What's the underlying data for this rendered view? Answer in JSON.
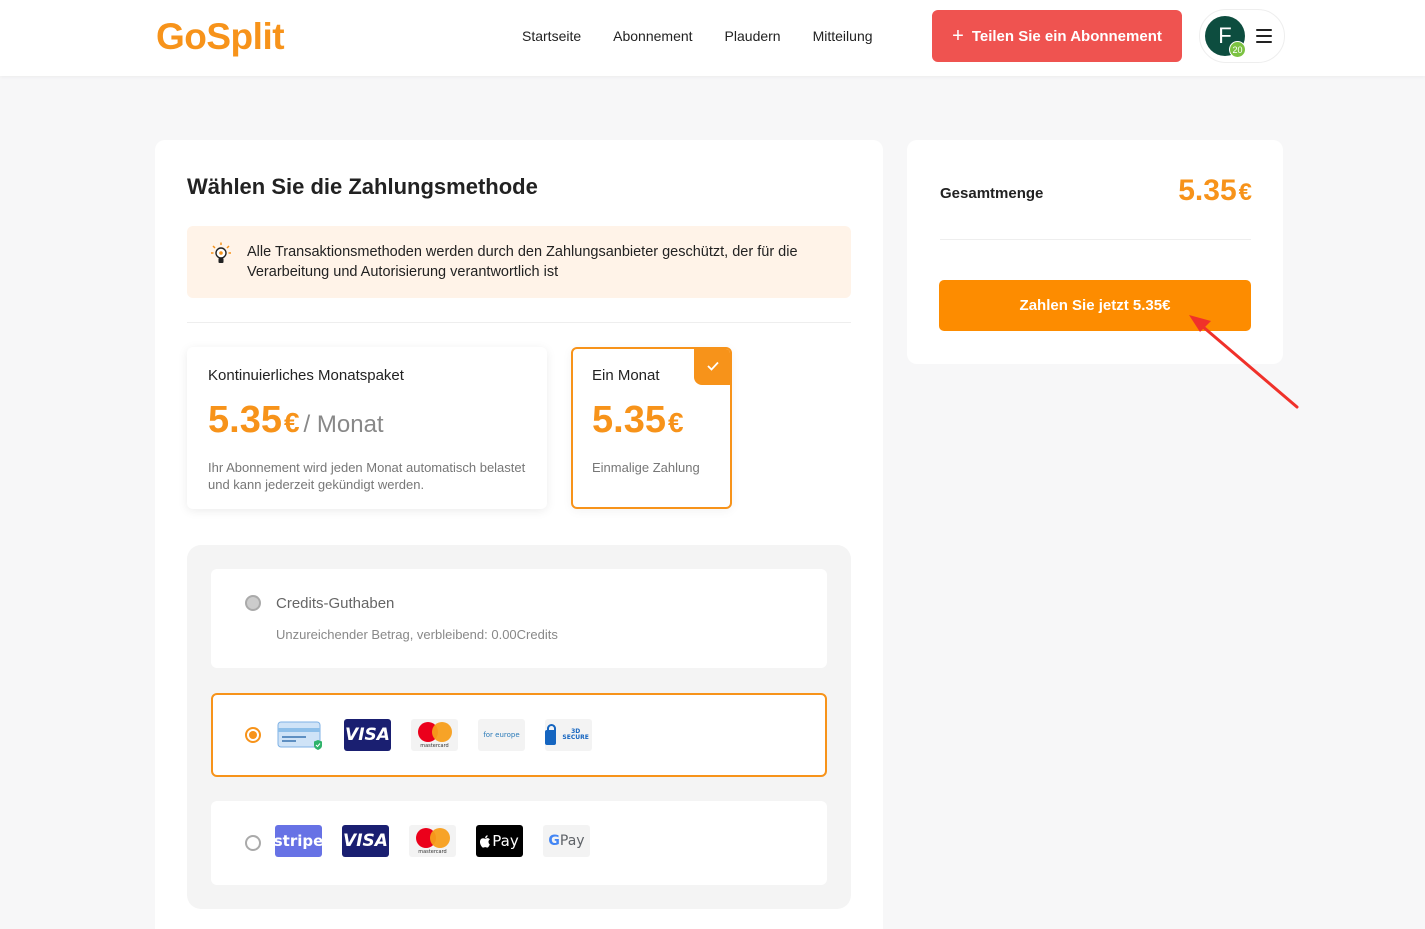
{
  "header": {
    "logo": "GoSplit",
    "nav": [
      "Startseite",
      "Abonnement",
      "Plaudern",
      "Mitteilung"
    ],
    "share_button": "Teilen Sie ein Abonnement",
    "avatar_letter": "F",
    "avatar_badge": "20"
  },
  "payment": {
    "title": "Wählen Sie die Zahlungsmethode",
    "notice": "Alle Transaktionsmethoden werden durch den Zahlungsanbieter geschützt, der für die Verarbeitung und Autorisierung verantwortlich ist",
    "plans": [
      {
        "name": "Kontinuierliches Monatspaket",
        "price": "5.35",
        "currency": "€",
        "period": "/ Monat",
        "description": "Ihr Abonnement wird jeden Monat automatisch belastet und kann jederzeit gekündigt werden.",
        "selected": false
      },
      {
        "name": "Ein Monat",
        "price": "5.35",
        "currency": "€",
        "description": "Einmalige Zahlung",
        "selected": true
      }
    ],
    "methods": {
      "credits": {
        "title": "Credits-Guthaben",
        "subtitle": "Unzureichender Betrag, verbleibend: 0.00Credits",
        "disabled": true
      },
      "card": {
        "selected": true,
        "logos": [
          "credit-card-icon",
          "visa-logo",
          "mastercard-logo",
          "europe-logo",
          "3d-secure-logo"
        ],
        "visa_text": "VISA",
        "mastercard_text": "mastercard",
        "europe_text": "for europe",
        "secure_text": "3D SECURE"
      },
      "wallets": {
        "selected": false,
        "logos": [
          "stripe-logo",
          "visa-logo",
          "mastercard-logo",
          "apple-pay-logo",
          "google-pay-logo"
        ],
        "stripe_text": "stripe",
        "visa_text": "VISA",
        "mastercard_text": "mastercard",
        "apple_pay_text": "Pay",
        "google_pay_g": "G",
        "google_pay_text": "Pay"
      }
    }
  },
  "summary": {
    "total_label": "Gesamtmenge",
    "total_value": "5.35",
    "currency": "€",
    "pay_button": "Zahlen Sie jetzt 5.35€"
  },
  "colors": {
    "brand": "#f7931a",
    "share_button": "#ef5350",
    "pay_button": "#fd8c00",
    "annotation_arrow": "#f0312a"
  }
}
